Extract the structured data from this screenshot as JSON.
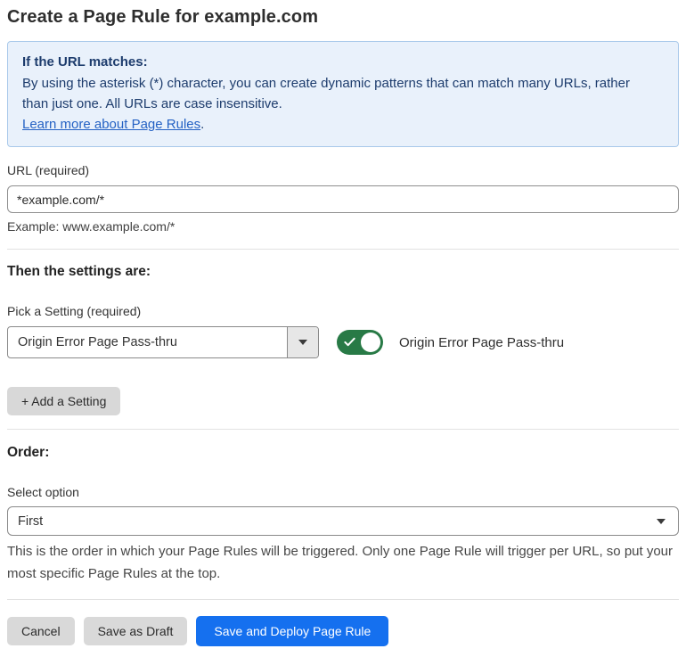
{
  "page": {
    "title": "Create a Page Rule for example.com"
  },
  "info_box": {
    "heading": "If the URL matches:",
    "body": "By using the asterisk (*) character, you can create dynamic patterns that can match many URLs, rather than just one. All URLs are case insensitive.",
    "link_label": "Learn more about Page Rules",
    "link_suffix": "."
  },
  "url_field": {
    "label": "URL (required)",
    "value": "*example.com/*",
    "example": "Example: www.example.com/*"
  },
  "settings_section": {
    "heading": "Then the settings are:",
    "picker_label": "Pick a Setting (required)",
    "picker_value": "Origin Error Page Pass-thru",
    "toggle": {
      "state": "on",
      "label": "Origin Error Page Pass-thru"
    },
    "add_setting_label": "+ Add a Setting"
  },
  "order_section": {
    "heading": "Order:",
    "select_label": "Select option",
    "select_value": "First",
    "description": "This is the order in which your Page Rules will be triggered. Only one Page Rule will trigger per URL, so put your most specific Page Rules at the top."
  },
  "footer": {
    "cancel_label": "Cancel",
    "save_draft_label": "Save as Draft",
    "save_deploy_label": "Save and Deploy Page Rule"
  },
  "colors": {
    "accent_blue": "#1570ef",
    "toggle_green": "#287a46",
    "info_background": "#e9f1fb",
    "info_border": "#a9c9ea",
    "info_text": "#1d3c6d",
    "link_blue": "#2562c4"
  }
}
